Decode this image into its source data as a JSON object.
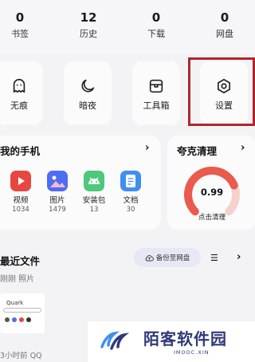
{
  "stats": [
    {
      "value": "0",
      "label": "书签"
    },
    {
      "value": "12",
      "label": "历史"
    },
    {
      "value": "0",
      "label": "下载"
    },
    {
      "value": "0",
      "label": "网盘"
    }
  ],
  "tools": [
    {
      "label": "无痕",
      "icon": "ghost-icon"
    },
    {
      "label": "暗夜",
      "icon": "moon-icon"
    },
    {
      "label": "工具箱",
      "icon": "toolbox-icon"
    },
    {
      "label": "设置",
      "icon": "gear-icon"
    }
  ],
  "phone": {
    "title": "我的手机",
    "apps": [
      {
        "name": "视频",
        "count": "1034",
        "icon": "video-icon",
        "color": "#e8473f"
      },
      {
        "name": "图片",
        "count": "1479",
        "icon": "image-icon",
        "color": "#4f6df1"
      },
      {
        "name": "安装包",
        "count": "13",
        "icon": "android-icon",
        "color": "#4cc97a"
      },
      {
        "name": "文档",
        "count": "30",
        "icon": "document-icon",
        "color": "#3f8ff2"
      }
    ]
  },
  "cleaner": {
    "title": "夸克清理",
    "value": "0.99",
    "fill_fraction": 0.75,
    "action": "点击清理",
    "gauge_color": "#ea5a4d",
    "track_color": "#f4d2cc"
  },
  "recent": {
    "title": "最近文件",
    "backup_label": "备份至网盘",
    "meta": "刚刚 照片",
    "thumb_title": "Quark",
    "thumb_caption": "3小时前 QQ"
  },
  "watermark": {
    "name": "陌客软件园",
    "url": "IMOOC.XIN",
    "color": "#2e3a78"
  }
}
